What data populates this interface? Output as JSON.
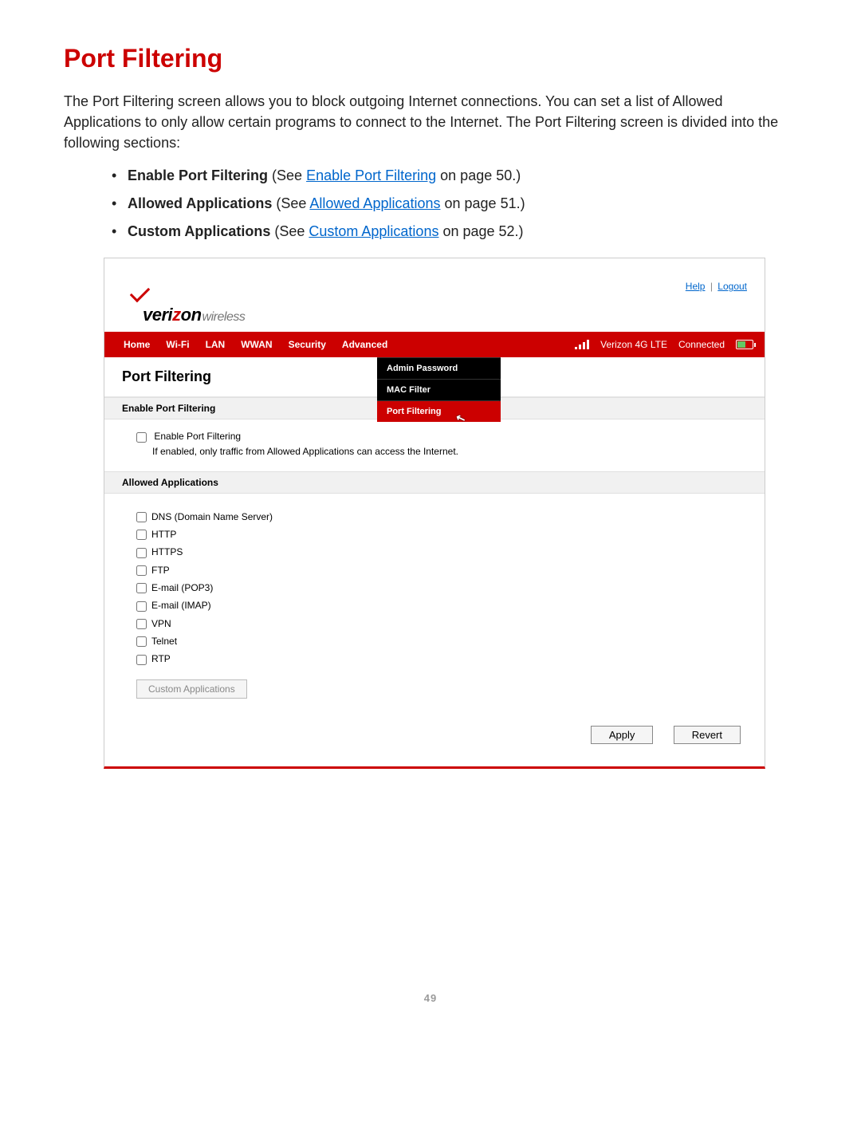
{
  "doc": {
    "title": "Port Filtering",
    "intro": "The Port Filtering screen allows you to block outgoing Internet connections. You can set a list of Allowed Applications to only allow certain programs to connect to the Internet. The Port Filtering screen is divided into the following sections:",
    "bullets": [
      {
        "bold": "Enable Port Filtering",
        "pre": " (See ",
        "link": "Enable Port Filtering",
        "post": " on page 50.)"
      },
      {
        "bold": "Allowed Applications",
        "pre": " (See ",
        "link": "Allowed Applications",
        "post": " on page 51.)"
      },
      {
        "bold": "Custom Applications",
        "pre": " (See ",
        "link": "Custom Applications",
        "post": " on page 52.)"
      }
    ],
    "page_number": "49"
  },
  "admin": {
    "top_links": {
      "help": "Help",
      "logout": "Logout"
    },
    "logo": {
      "brand_pre": "veri",
      "brand_z": "z",
      "brand_post": "on",
      "sub": "wireless"
    },
    "nav": {
      "items": [
        "Home",
        "Wi-Fi",
        "LAN",
        "WWAN",
        "Security",
        "Advanced"
      ],
      "carrier": "Verizon  4G LTE",
      "status": "Connected"
    },
    "security_menu": {
      "items": [
        "Admin Password",
        "MAC Filter",
        "Port Filtering"
      ],
      "active_index": 2
    },
    "panel": {
      "title": "Port Filtering",
      "enable_section": {
        "header": "Enable Port Filtering",
        "checkbox_label": "Enable Port Filtering",
        "hint": "If enabled, only traffic from Allowed Applications can access the Internet."
      },
      "allowed_section": {
        "header": "Allowed Applications",
        "apps": [
          "DNS (Domain Name Server)",
          "HTTP",
          "HTTPS",
          "FTP",
          "E-mail (POP3)",
          "E-mail (IMAP)",
          "VPN",
          "Telnet",
          "RTP"
        ],
        "custom_button": "Custom Applications"
      },
      "actions": {
        "apply": "Apply",
        "revert": "Revert"
      }
    }
  }
}
